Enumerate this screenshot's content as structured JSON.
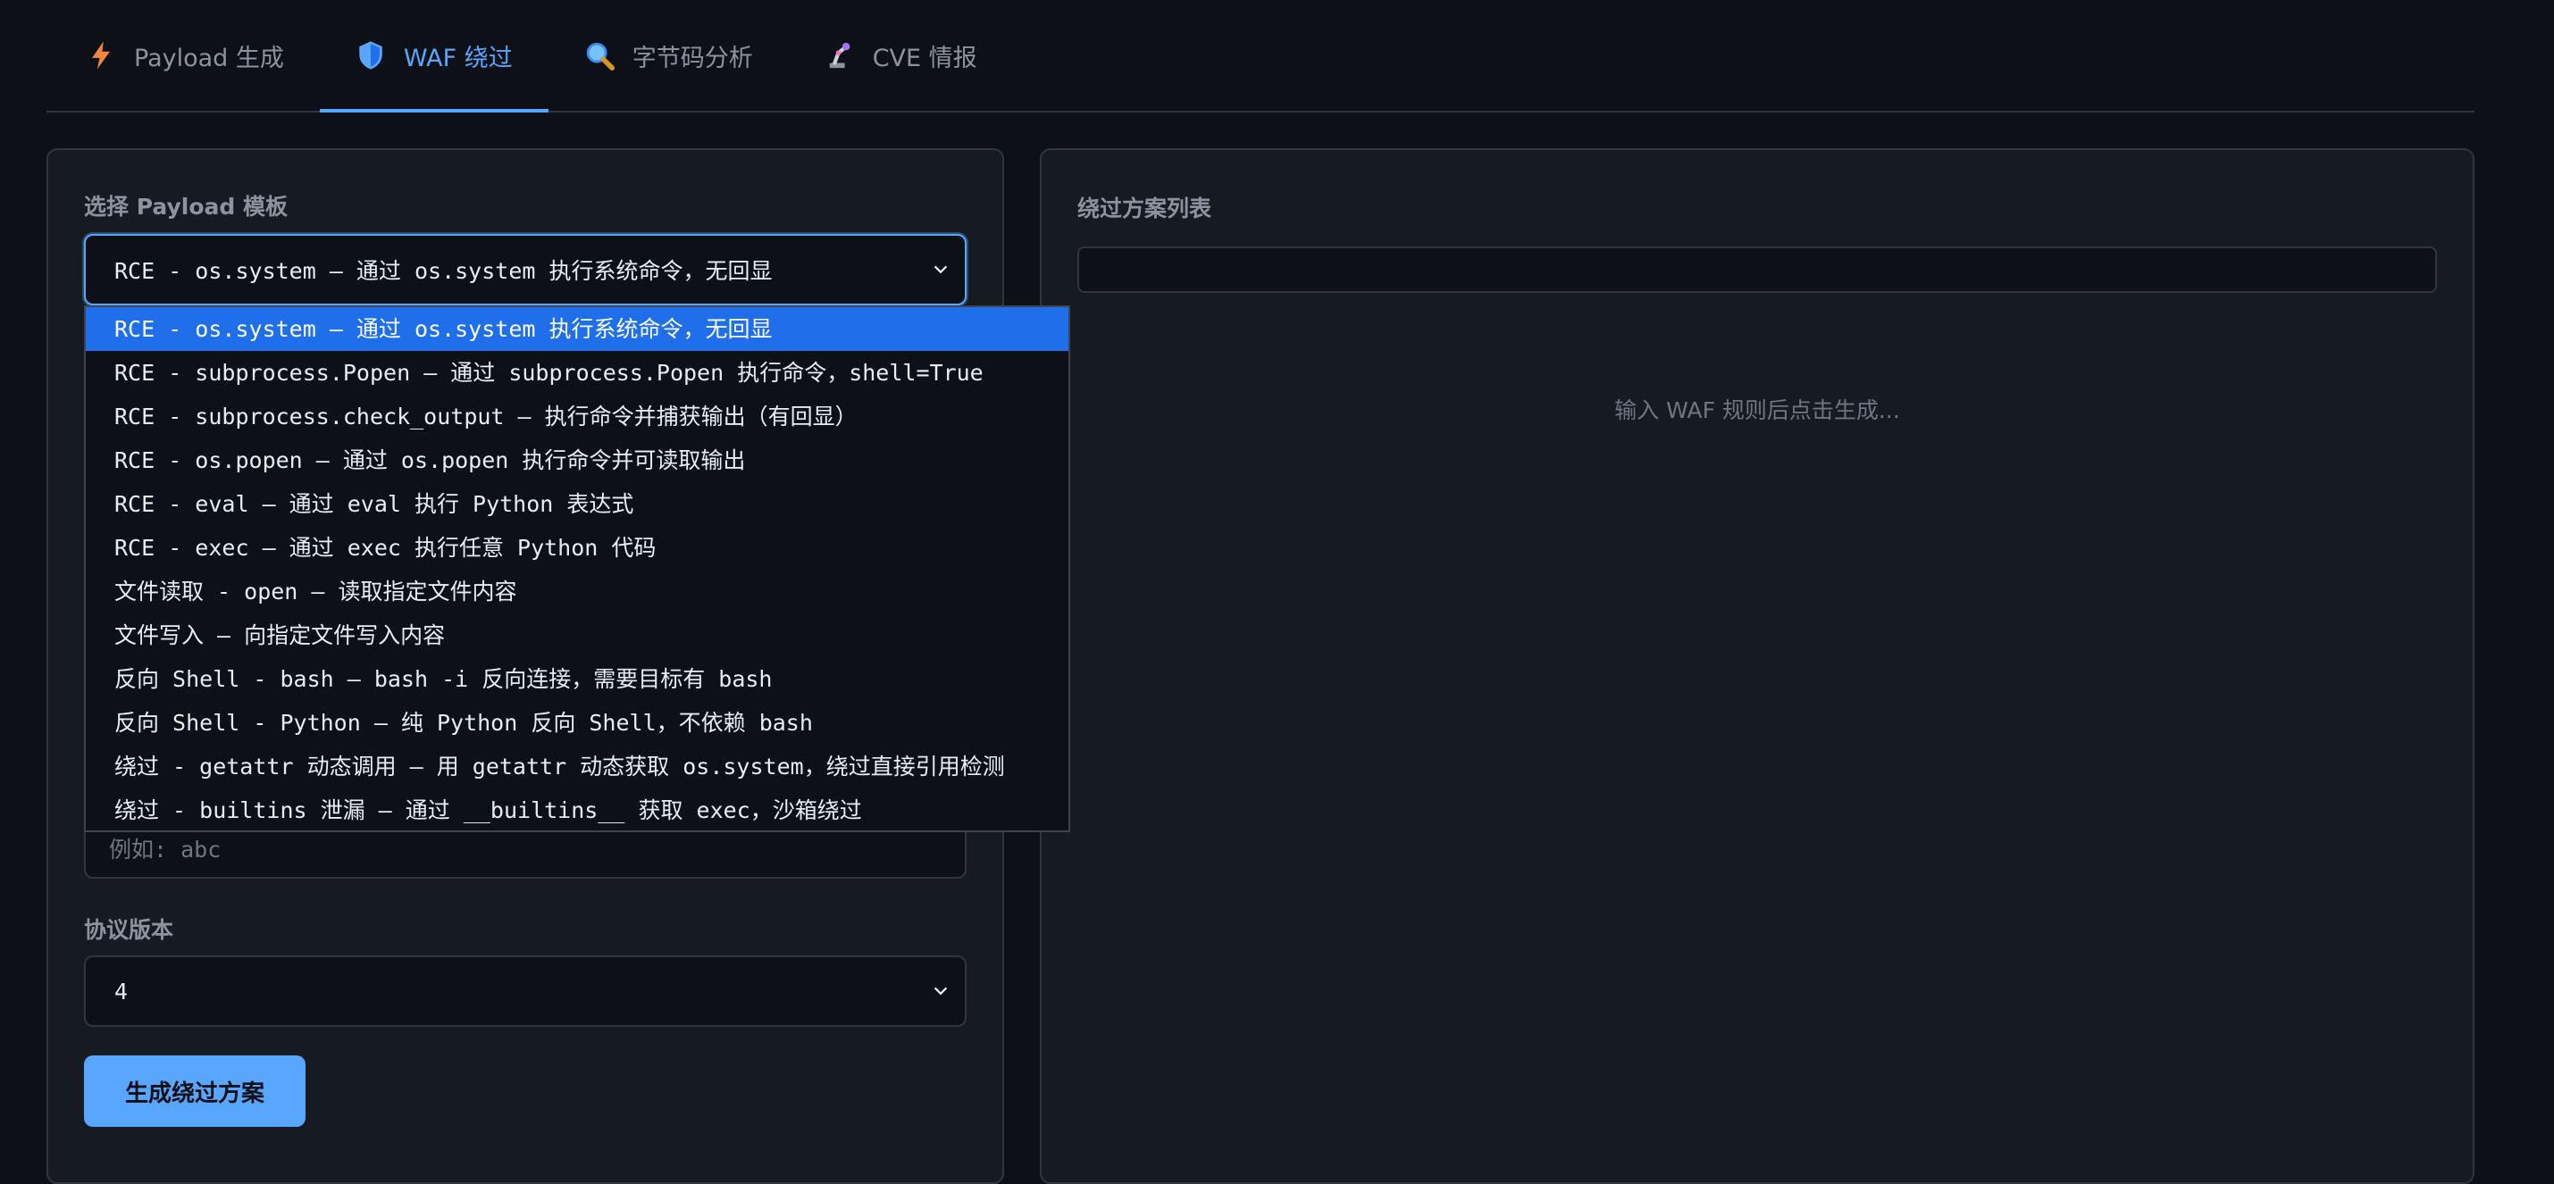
{
  "tabs": [
    {
      "label": "Payload 生成",
      "icon": "lightning-icon"
    },
    {
      "label": "WAF 绕过",
      "icon": "shield-icon"
    },
    {
      "label": "字节码分析",
      "icon": "magnifier-icon"
    },
    {
      "label": "CVE 情报",
      "icon": "robot-arm-icon"
    }
  ],
  "left": {
    "template_label": "选择 Payload 模板",
    "template_selected": "RCE - os.system — 通过 os.system 执行系统命令，无回显",
    "template_options": [
      "RCE - os.system — 通过 os.system 执行系统命令，无回显",
      "RCE - subprocess.Popen — 通过 subprocess.Popen 执行命令，shell=True",
      "RCE - subprocess.check_output — 执行命令并捕获输出（有回显）",
      "RCE - os.popen — 通过 os.popen 执行命令并可读取输出",
      "RCE - eval — 通过 eval 执行 Python 表达式",
      "RCE - exec — 通过 exec 执行任意 Python 代码",
      "文件读取 - open — 读取指定文件内容",
      "文件写入 — 向指定文件写入内容",
      "反向 Shell - bash — bash -i 反向连接，需要目标有 bash",
      "反向 Shell - Python — 纯 Python 反向 Shell，不依赖 bash",
      "绕过 - getattr 动态调用 — 用 getattr 动态获取 os.system，绕过直接引用检测",
      "绕过 - builtins 泄漏 — 通过 __builtins__ 获取 exec，沙箱绕过"
    ],
    "waf_input_placeholder": "例如: abc",
    "protocol_label": "协议版本",
    "protocol_value": "4",
    "generate_button": "生成绕过方案"
  },
  "right": {
    "title": "绕过方案列表",
    "empty_text": "输入 WAF 规则后点击生成..."
  },
  "colors": {
    "accent": "#58a6ff",
    "background": "#0d1117",
    "card": "#161b22",
    "selected_option": "#1f6feb"
  }
}
